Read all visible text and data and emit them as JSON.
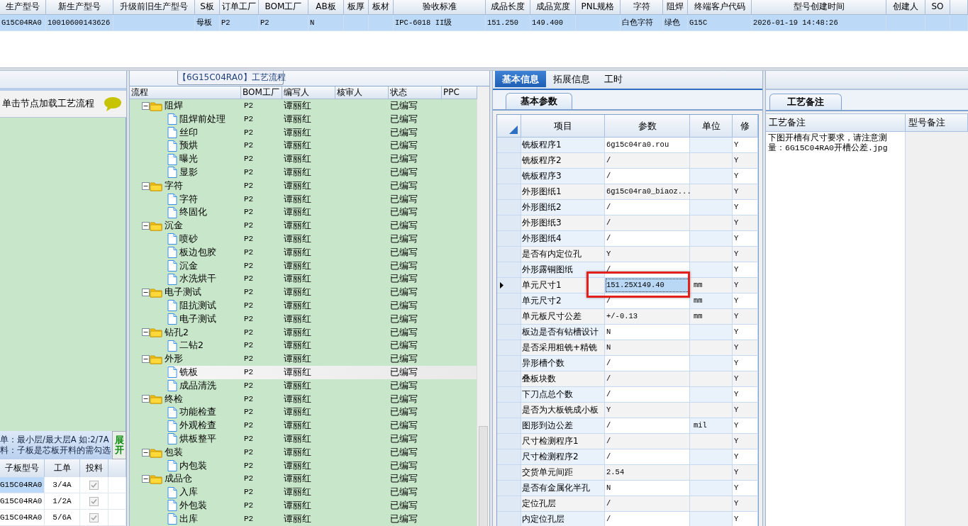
{
  "record_grid": {
    "columns": [
      "生产型号",
      "新生产型号",
      "升级前旧生产型号",
      "S板",
      "订单工厂",
      "BOM工厂",
      "AB板",
      "板厚",
      "板材",
      "验收标准",
      "成品长度",
      "成品宽度",
      "PNL规格",
      "字符",
      "阻焊",
      "终端客户代码",
      "型号创建时间",
      "创建人",
      "SO"
    ],
    "rows": [
      {
        "selected": true,
        "cells": [
          "G15C04RA0",
          "10010600143626",
          null,
          "母板",
          "P2",
          "P2",
          "N",
          null,
          null,
          "IPC-6018 II级",
          "151.250",
          "149.400",
          null,
          "白色字符",
          "绿色",
          "G15C",
          "2026-01-19 14:48:26",
          null,
          null
        ]
      }
    ]
  },
  "left_panel": {
    "hint": "单击节点加载工艺流程",
    "info_lines": [
      "单：最小层/最大层A 如:2/7A",
      "料：子板是芯板开料的需勾选"
    ],
    "expand_button": "展开",
    "columns": [
      "子板型号",
      "工单",
      "投料"
    ],
    "rows": [
      {
        "model": "G15C04RA0",
        "order": "3/4A",
        "checked": true,
        "selected": true
      },
      {
        "model": "G15C04RA0",
        "order": "1/2A",
        "checked": true,
        "selected": false
      },
      {
        "model": "G15C04RA0",
        "order": "5/6A",
        "checked": true,
        "selected": false
      }
    ]
  },
  "flow": {
    "title": "【6G15C04RA0】工艺流程",
    "columns": [
      "流程",
      "BOM工厂",
      "编写人",
      "核审人",
      "状态",
      "PPC"
    ],
    "steps": [
      {
        "name": "阻焊",
        "factory": "P2",
        "writer": "谭丽红",
        "status": "已编写",
        "expanded": true,
        "selected": false,
        "children": [
          {
            "name": "阻焊前处理",
            "factory": "P2",
            "writer": "谭丽红",
            "status": "已编写",
            "selected": false
          },
          {
            "name": "丝印",
            "factory": "P2",
            "writer": "谭丽红",
            "status": "已编写",
            "selected": false
          },
          {
            "name": "预烘",
            "factory": "P2",
            "writer": "谭丽红",
            "status": "已编写",
            "selected": false
          },
          {
            "name": "曝光",
            "factory": "P2",
            "writer": "谭丽红",
            "status": "已编写",
            "selected": false
          },
          {
            "name": "显影",
            "factory": "P2",
            "writer": "谭丽红",
            "status": "已编写",
            "selected": false
          }
        ]
      },
      {
        "name": "字符",
        "factory": "P2",
        "writer": "谭丽红",
        "status": "已编写",
        "expanded": true,
        "selected": false,
        "children": [
          {
            "name": "字符",
            "factory": "P2",
            "writer": "谭丽红",
            "status": "已编写",
            "selected": false
          },
          {
            "name": "终固化",
            "factory": "P2",
            "writer": "谭丽红",
            "status": "已编写",
            "selected": false
          }
        ]
      },
      {
        "name": "沉金",
        "factory": "P2",
        "writer": "谭丽红",
        "status": "已编写",
        "expanded": true,
        "selected": false,
        "children": [
          {
            "name": "喷砂",
            "factory": "P2",
            "writer": "谭丽红",
            "status": "已编写",
            "selected": false
          },
          {
            "name": "板边包胶",
            "factory": "P2",
            "writer": "谭丽红",
            "status": "已编写",
            "selected": false
          },
          {
            "name": "沉金",
            "factory": "P2",
            "writer": "谭丽红",
            "status": "已编写",
            "selected": false
          },
          {
            "name": "水洗烘干",
            "factory": "P2",
            "writer": "谭丽红",
            "status": "已编写",
            "selected": false
          }
        ]
      },
      {
        "name": "电子测试",
        "factory": "P2",
        "writer": "谭丽红",
        "status": "已编写",
        "expanded": true,
        "selected": false,
        "children": [
          {
            "name": "阻抗测试",
            "factory": "P2",
            "writer": "谭丽红",
            "status": "已编写",
            "selected": false
          },
          {
            "name": "电子测试",
            "factory": "P2",
            "writer": "谭丽红",
            "status": "已编写",
            "selected": false
          }
        ]
      },
      {
        "name": "钻孔2",
        "factory": "P2",
        "writer": "谭丽红",
        "status": "已编写",
        "expanded": true,
        "selected": false,
        "children": [
          {
            "name": "二钻2",
            "factory": "P2",
            "writer": "谭丽红",
            "status": "已编写",
            "selected": false
          }
        ]
      },
      {
        "name": "外形",
        "factory": "P2",
        "writer": "谭丽红",
        "status": "已编写",
        "expanded": true,
        "selected": false,
        "children": [
          {
            "name": "铣板",
            "factory": "P2",
            "writer": "谭丽红",
            "status": "已编写",
            "selected": true
          },
          {
            "name": "成品清洗",
            "factory": "P2",
            "writer": "谭丽红",
            "status": "已编写",
            "selected": false
          }
        ]
      },
      {
        "name": "终检",
        "factory": "P2",
        "writer": "谭丽红",
        "status": "已编写",
        "expanded": true,
        "selected": false,
        "children": [
          {
            "name": "功能检查",
            "factory": "P2",
            "writer": "谭丽红",
            "status": "已编写",
            "selected": false
          },
          {
            "name": "外观检查",
            "factory": "P2",
            "writer": "谭丽红",
            "status": "已编写",
            "selected": false
          },
          {
            "name": "烘板整平",
            "factory": "P2",
            "writer": "谭丽红",
            "status": "已编写",
            "selected": false
          }
        ]
      },
      {
        "name": "包装",
        "factory": "P2",
        "writer": "谭丽红",
        "status": "已编写",
        "expanded": true,
        "selected": false,
        "children": [
          {
            "name": "内包装",
            "factory": "P2",
            "writer": "谭丽红",
            "status": "已编写",
            "selected": false
          }
        ]
      },
      {
        "name": "成品仓",
        "factory": "P2",
        "writer": "谭丽红",
        "status": "已编写",
        "expanded": true,
        "selected": false,
        "children": [
          {
            "name": "入库",
            "factory": "P2",
            "writer": "谭丽红",
            "status": "已编写",
            "selected": false
          },
          {
            "name": "外包装",
            "factory": "P2",
            "writer": "谭丽红",
            "status": "已编写",
            "selected": false
          },
          {
            "name": "出库",
            "factory": "P2",
            "writer": "谭丽红",
            "status": "已编写",
            "selected": false
          }
        ]
      }
    ]
  },
  "details": {
    "tabs": [
      {
        "label": "基本信息",
        "selected": true
      },
      {
        "label": "拓展信息",
        "selected": false
      },
      {
        "label": "工时",
        "selected": false
      }
    ],
    "subtab": "基本参数",
    "columns": [
      "项目",
      "参数",
      "单位",
      "修"
    ],
    "rows": [
      {
        "item": "铣板程序1",
        "value": "6g15c04ra0.rou",
        "modified": "Y",
        "selected": false
      },
      {
        "item": "铣板程序2",
        "value": "/",
        "modified": "Y",
        "selected": false
      },
      {
        "item": "铣板程序3",
        "value": "/",
        "modified": "Y",
        "selected": false
      },
      {
        "item": "外形图纸1",
        "value": "6g15c04ra0_biaoz...",
        "modified": "Y",
        "selected": false
      },
      {
        "item": "外形图纸2",
        "value": "/",
        "modified": "Y",
        "selected": false
      },
      {
        "item": "外形图纸3",
        "value": "/",
        "modified": "Y",
        "selected": false
      },
      {
        "item": "外形图纸4",
        "value": "/",
        "modified": "Y",
        "selected": false
      },
      {
        "item": "是否有内定位孔",
        "value": "Y",
        "modified": "Y",
        "selected": false
      },
      {
        "item": "外形露铜图纸",
        "value": "/",
        "modified": "Y",
        "selected": false
      },
      {
        "item": "单元尺寸1",
        "value": "151.25X149.40",
        "unit": "mm",
        "modified": "Y",
        "selected": true
      },
      {
        "item": "单元尺寸2",
        "value": "/",
        "unit": "mm",
        "modified": "Y",
        "selected": false
      },
      {
        "item": "单元板尺寸公差",
        "value": "+/-0.13",
        "unit": "mm",
        "modified": "Y",
        "selected": false
      },
      {
        "item": "板边是否有钻槽设计",
        "value": "N",
        "modified": "Y",
        "selected": false
      },
      {
        "item": "是否采用粗铣+精铣",
        "value": "N",
        "modified": "Y",
        "selected": false
      },
      {
        "item": "异形槽个数",
        "value": "/",
        "modified": "Y",
        "selected": false
      },
      {
        "item": "叠板块数",
        "value": "/",
        "modified": "Y",
        "selected": false
      },
      {
        "item": "下刀点总个数",
        "value": "/",
        "modified": "Y",
        "selected": false
      },
      {
        "item": "是否为大板铣成小板",
        "value": "Y",
        "modified": "Y",
        "selected": false
      },
      {
        "item": "图形到边公差",
        "value": "/",
        "unit": "mil",
        "modified": "Y",
        "selected": false
      },
      {
        "item": "尺寸检测程序1",
        "value": "/",
        "modified": "Y",
        "selected": false
      },
      {
        "item": "尺寸检测程序2",
        "value": "/",
        "modified": "Y",
        "selected": false
      },
      {
        "item": "交货单元间距",
        "value": "2.54",
        "modified": "Y",
        "selected": false
      },
      {
        "item": "是否有金属化半孔",
        "value": "N",
        "modified": "Y",
        "selected": false
      },
      {
        "item": "定位孔层",
        "value": "/",
        "modified": "Y",
        "selected": false
      },
      {
        "item": "内定位孔层",
        "value": "/",
        "modified": "Y",
        "selected": false
      }
    ]
  },
  "notes": {
    "tab": "工艺备注",
    "columns": [
      "工艺备注",
      "型号备注"
    ],
    "process_note": "下图开槽有尺寸要求，请注意测量：6G15C04RA0开槽公差.jpg"
  }
}
